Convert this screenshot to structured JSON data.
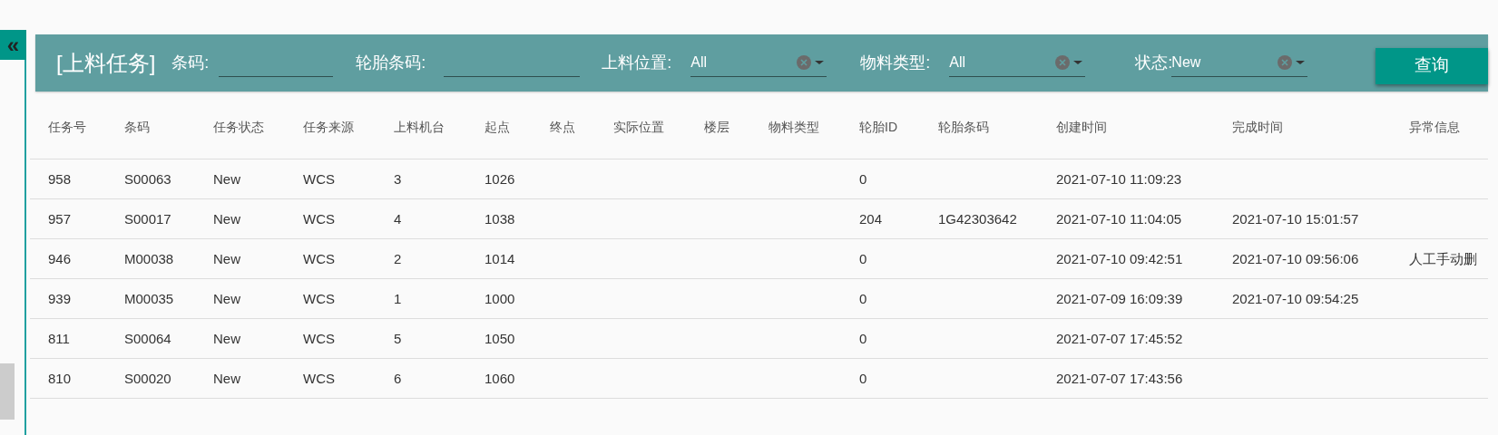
{
  "sidebar_toggle": {
    "label": "«"
  },
  "filter_bar": {
    "title": "[上料任务]",
    "filters": [
      {
        "kind": "text",
        "label": "条码:"
      },
      {
        "kind": "text",
        "label": "轮胎条码:"
      },
      {
        "kind": "select",
        "label": "上料位置:",
        "value": "All"
      },
      {
        "kind": "select",
        "label": "物料类型:",
        "value": "All"
      },
      {
        "kind": "select",
        "label": "状态:",
        "value": "New"
      }
    ],
    "button": "查询"
  },
  "table": {
    "columns": [
      "任务号",
      "条码",
      "任务状态",
      "任务来源",
      "上料机台",
      "起点",
      "终点",
      "实际位置",
      "楼层",
      "物料类型",
      "轮胎ID",
      "轮胎条码",
      "创建时间",
      "完成时间",
      "异常信息"
    ],
    "rows": [
      [
        "958",
        "S00063",
        "New",
        "WCS",
        "3",
        "1026",
        null,
        null,
        null,
        null,
        "0",
        null,
        "2021-07-10 11:09:23",
        null,
        null
      ],
      [
        "957",
        "S00017",
        "New",
        "WCS",
        "4",
        "1038",
        null,
        null,
        null,
        null,
        "204",
        "1G42303642",
        "2021-07-10 11:04:05",
        "2021-07-10 15:01:57",
        null
      ],
      [
        "946",
        "M00038",
        "New",
        "WCS",
        "2",
        "1014",
        null,
        null,
        null,
        null,
        "0",
        null,
        "2021-07-10 09:42:51",
        "2021-07-10 09:56:06",
        "人工手动删"
      ],
      [
        "939",
        "M00035",
        "New",
        "WCS",
        "1",
        "1000",
        null,
        null,
        null,
        null,
        "0",
        null,
        "2021-07-09 16:09:39",
        "2021-07-10 09:54:25",
        null
      ],
      [
        "811",
        "S00064",
        "New",
        "WCS",
        "5",
        "1050",
        null,
        null,
        null,
        null,
        "0",
        null,
        "2021-07-07 17:45:52",
        null,
        null
      ],
      [
        "810",
        "S00020",
        "New",
        "WCS",
        "6",
        "1060",
        null,
        null,
        null,
        null,
        "0",
        null,
        "2021-07-07 17:43:56",
        null,
        null
      ]
    ]
  }
}
